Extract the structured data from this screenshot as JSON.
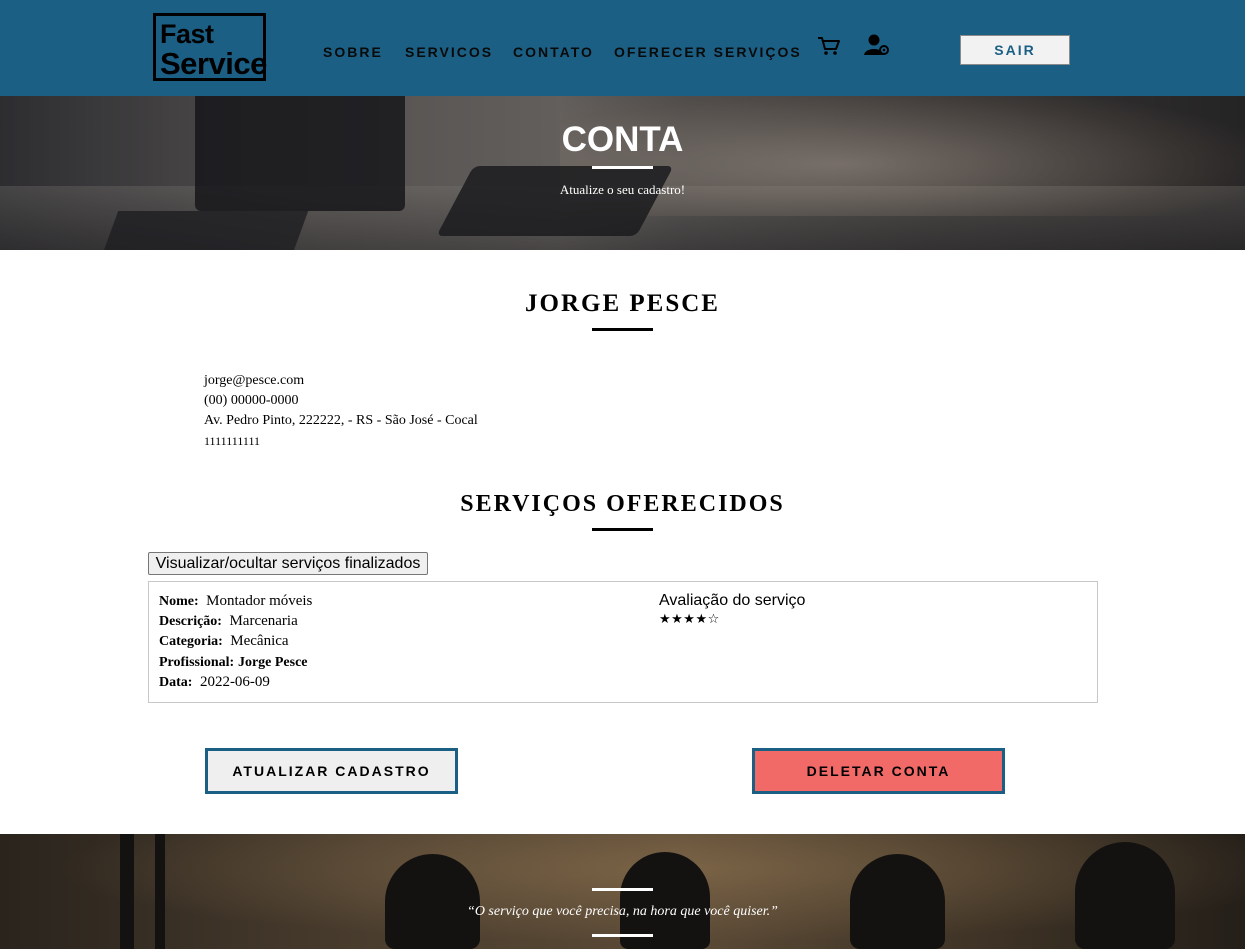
{
  "header": {
    "logo_line1": "Fast",
    "logo_line2": "Service",
    "nav": [
      "SOBRE",
      "SERVICOS",
      "CONTATO",
      "OFERECER SERVIÇOS"
    ],
    "cart_icon": "cart-icon",
    "user_icon": "user-settings-icon",
    "logout_label": "SAIR",
    "brand_color": "#1b5f85"
  },
  "hero": {
    "title": "CONTA",
    "subtitle": "Atualize o seu cadastro!"
  },
  "profile": {
    "name": "JORGE PESCE",
    "email": "jorge@pesce.com",
    "phone": "(00) 00000-0000",
    "address": "Av. Pedro Pinto, 222222, - RS - São José - Cocal",
    "document": "1111111111"
  },
  "services": {
    "title": "SERVIÇOS OFERECIDOS",
    "toggle_label": "Visualizar/ocultar serviços finalizados",
    "items": [
      {
        "name_label": "Nome:",
        "name": "Montador móveis",
        "description_label": "Descrição:",
        "description": "Marcenaria",
        "category_label": "Categoria:",
        "category": "Mecânica",
        "professional_label": "Profissional:",
        "professional": "Jorge Pesce",
        "date_label": "Data:",
        "date": "2022-06-09",
        "rating_label": "Avaliação do serviço",
        "rating_stars": "★★★★☆",
        "rating": 4
      }
    ]
  },
  "actions": {
    "update_label": "ATUALIZAR CADASTRO",
    "delete_label": "DELETAR CONTA",
    "delete_color": "#f26a68"
  },
  "footer": {
    "quote": "“O serviço que você precisa, na hora que você quiser.”"
  }
}
